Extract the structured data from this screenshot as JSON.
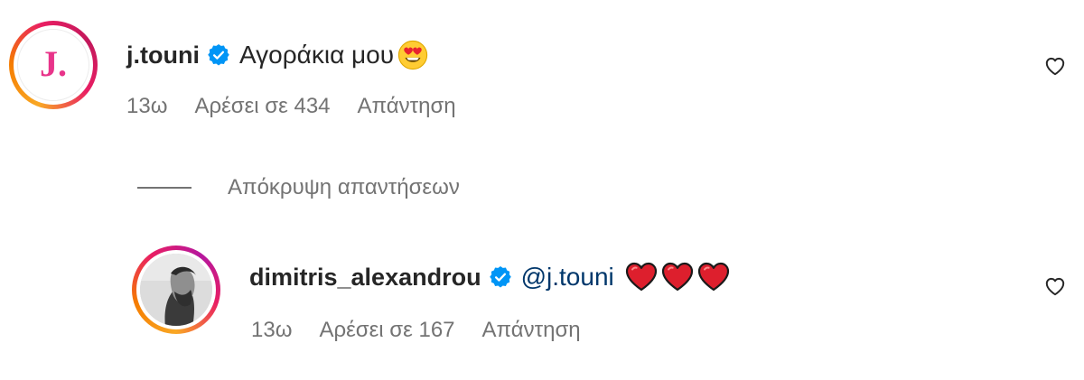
{
  "comments": [
    {
      "username": "j.touni",
      "avatar_letter": "J.",
      "verified": true,
      "text": "Αγοράκια μου",
      "emoji": "heart-eyes-face",
      "time": "13ω",
      "likes": "Αρέσει σε 434",
      "reply_label": "Απάντηση"
    },
    {
      "username": "dimitris_alexandrou",
      "verified": true,
      "mention": "@j.touni",
      "emoji": [
        "red-heart",
        "red-heart",
        "red-heart"
      ],
      "time": "13ω",
      "likes": "Αρέσει σε 167",
      "reply_label": "Απάντηση"
    }
  ],
  "hide_replies_label": "Απόκρυψη απαντήσεων",
  "colors": {
    "verified_badge": "#0095f6",
    "mention": "#00376b",
    "meta_text": "#737373",
    "avatar_gradient": [
      "#f9a825",
      "#e91e63",
      "#c2185b"
    ],
    "logo_pink": "#e8348a"
  }
}
